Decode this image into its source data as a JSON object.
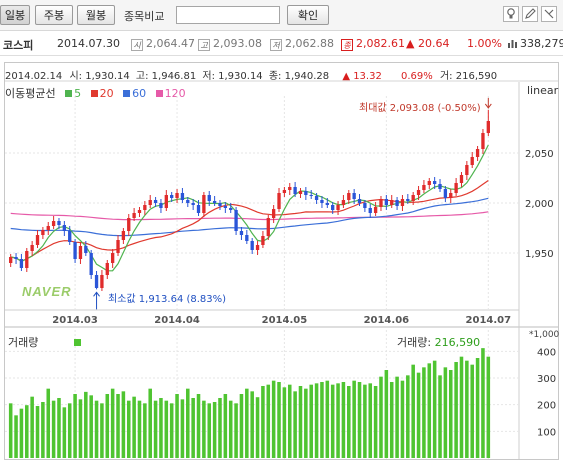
{
  "toolbar": {
    "tabs": [
      {
        "label": "일봉",
        "active": true
      },
      {
        "label": "주봉",
        "active": false
      },
      {
        "label": "월봉",
        "active": false
      }
    ],
    "compare_label": "종목비교",
    "compare_value": "",
    "confirm_label": "확인"
  },
  "index": {
    "name": "코스피",
    "date": "2014.07.30",
    "open_badge": "시",
    "open": "2,064.47",
    "high_badge": "고",
    "high": "2,093.08",
    "low_badge": "저",
    "low": "2,062.88",
    "close_badge": "종",
    "close": "2,082.61",
    "change": "▲ 20.64",
    "change_pct": "1.00%",
    "volume": "338,279"
  },
  "chart": {
    "header_date": "2014.02.14",
    "header_open": "시: 1,930.14",
    "header_high": "고: 1,946.81",
    "header_low": "저: 1,930.14",
    "header_close": "종: 1,940.28",
    "header_change": "▲ 13.32",
    "header_pct": "0.69%",
    "header_vol": "거: 216,590",
    "ma_label": "이동평균선",
    "ma": [
      {
        "label": "5",
        "color": "#4fb44f"
      },
      {
        "label": "20",
        "color": "#e03a2f"
      },
      {
        "label": "60",
        "color": "#3b6fd8"
      },
      {
        "label": "120",
        "color": "#e65aa8"
      }
    ],
    "scale": "linear",
    "max_annotation": "최대값 2,093.08 (-0.50%)",
    "min_annotation": "최소값 1,913.64 (8.83%)",
    "watermark": "NAVER",
    "volume_label": "거래량",
    "volume_current_label": "거래량:",
    "volume_current": "216,590",
    "volume_unit": "*1,000",
    "volume_color": "#4fc431",
    "up_color": "#e02b2b",
    "down_color": "#2a55d8"
  },
  "chart_data": {
    "type": "candlestick",
    "y_ticks": [
      1950,
      2000,
      2050
    ],
    "y_tick_labels": [
      "1,950",
      "2,000",
      "2,050"
    ],
    "ylim": [
      1903,
      2103
    ],
    "x_ticks": [
      {
        "label": "2014.03",
        "index": 12
      },
      {
        "label": "2014.04",
        "index": 31
      },
      {
        "label": "2014.05",
        "index": 51
      },
      {
        "label": "2014.06",
        "index": 70
      },
      {
        "label": "2014.07",
        "index": 89
      }
    ],
    "close": [
      1946,
      1944,
      1935,
      1952,
      1958,
      1968,
      1973,
      1977,
      1982,
      1978,
      1972,
      1961,
      1944,
      1957,
      1950,
      1928,
      1915,
      1928,
      1940,
      1950,
      1963,
      1972,
      1985,
      1990,
      1993,
      1998,
      2003,
      2000,
      1995,
      2008,
      2005,
      2010,
      2003,
      2000,
      1998,
      1990,
      2008,
      2002,
      2000,
      1997,
      1995,
      1993,
      1972,
      1968,
      1962,
      1953,
      1958,
      1967,
      1985,
      1994,
      2010,
      2013,
      2016,
      2009,
      2012,
      2008,
      2007,
      2003,
      2000,
      1998,
      1993,
      1998,
      2003,
      2010,
      2004,
      2000,
      1995,
      1990,
      1996,
      2004,
      1998,
      2003,
      1997,
      2004,
      2002,
      2008,
      2013,
      2018,
      2022,
      2019,
      2014,
      2005,
      2010,
      2020,
      2028,
      2038,
      2046,
      2054,
      2070,
      2082
    ],
    "volume": [
      205,
      160,
      185,
      198,
      230,
      195,
      210,
      260,
      215,
      225,
      190,
      205,
      240,
      220,
      248,
      235,
      215,
      205,
      240,
      260,
      240,
      250,
      215,
      230,
      215,
      205,
      260,
      215,
      225,
      215,
      205,
      240,
      220,
      260,
      225,
      240,
      215,
      205,
      210,
      225,
      240,
      215,
      205,
      240,
      260,
      250,
      228,
      270,
      275,
      290,
      285,
      265,
      275,
      250,
      270,
      260,
      275,
      280,
      285,
      290,
      275,
      280,
      285,
      270,
      290,
      285,
      275,
      280,
      270,
      305,
      330,
      285,
      305,
      290,
      310,
      350,
      320,
      340,
      355,
      365,
      310,
      340,
      330,
      360,
      380,
      365,
      350,
      375,
      412,
      380
    ],
    "volume_ticks": [
      100,
      200,
      300,
      400
    ],
    "volume_ylim": [
      0,
      420
    ]
  }
}
